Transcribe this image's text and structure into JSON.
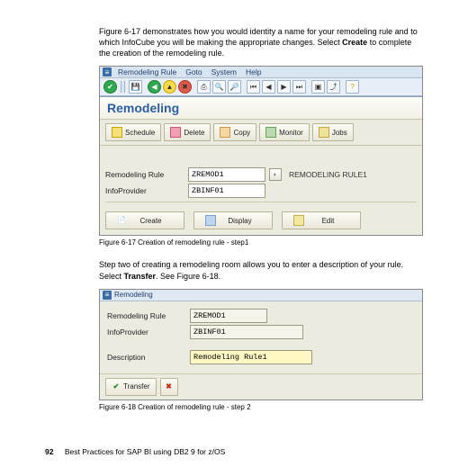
{
  "para1": {
    "pre": "Figure 6-17 demonstrates how you would identity a name for your remodeling rule and to which InfoCube you will be making the appropriate changes. Select ",
    "bold": "Create",
    "post": " to complete the creation of the remodeling rule."
  },
  "fig1": {
    "menuitems": [
      "Remodeling Rule",
      "Goto",
      "System",
      "Help"
    ],
    "heading": "Remodeling",
    "buttons": {
      "schedule": "Schedule",
      "delete": "Delete",
      "copy": "Copy",
      "monitor": "Monitor",
      "jobs": "Jobs"
    },
    "labels": {
      "rule": "Remodeling Rule",
      "info": "InfoProvider"
    },
    "values": {
      "rule": "ZREMOD1",
      "info": "ZBINF01",
      "rule_trail": "REMODELING RULE1"
    },
    "actions": {
      "create": "Create",
      "display": "Display",
      "edit": "Edit"
    },
    "caption": "Figure 6-17   Creation of remodeling rule - step1"
  },
  "para2": {
    "pre": "Step two of creating a remodeling room allows you to enter a description of your rule. Select ",
    "bold": "Transfer",
    "post": ". See Figure 6-18."
  },
  "fig2": {
    "title": "Remodeling",
    "labels": {
      "rule": "Remodeling Rule",
      "info": "InfoProvider",
      "desc": "Description"
    },
    "values": {
      "rule": "ZREMOD1",
      "info": "ZBINF01",
      "desc": "Remodeling Rule1"
    },
    "transfer": "Transfer",
    "caption": "Figure 6-18   Creation of remodeling rule - step 2"
  },
  "footer": {
    "page": "92",
    "title": "Best Practices for SAP BI using DB2 9 for z/OS"
  }
}
